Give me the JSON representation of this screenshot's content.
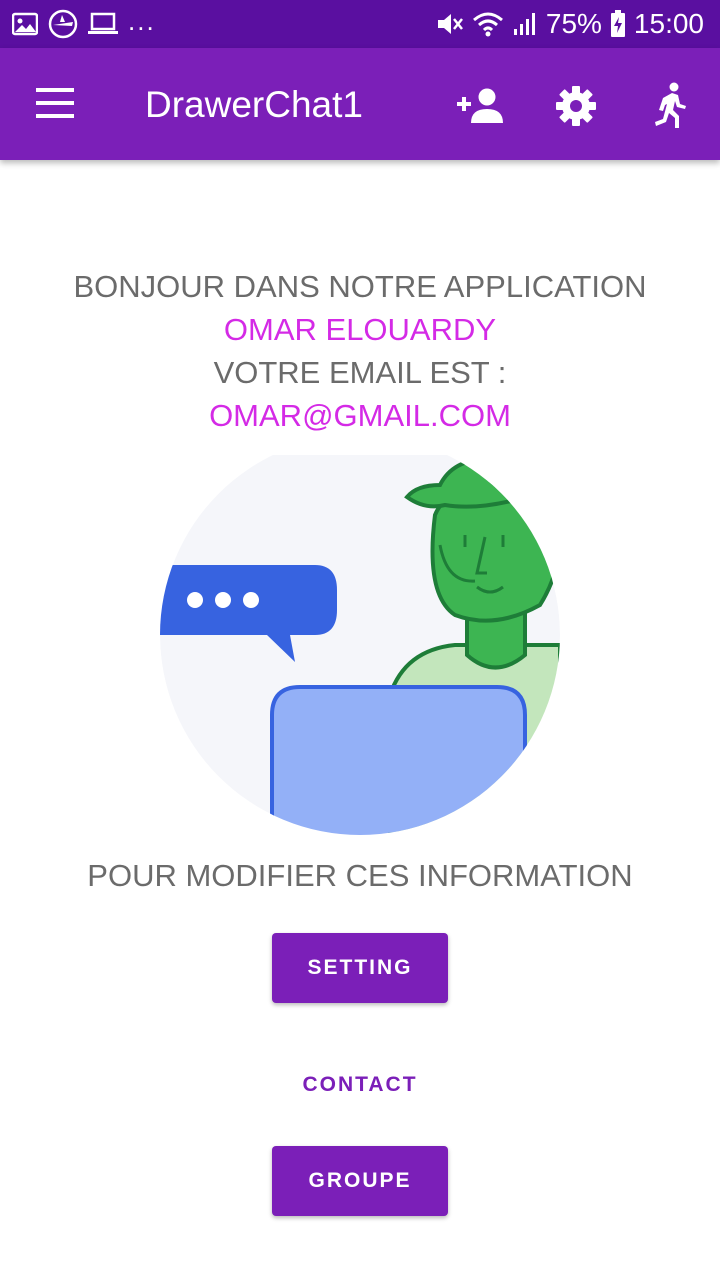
{
  "status_bar": {
    "left_icons": [
      "image-icon",
      "app-badge-icon",
      "laptop-icon"
    ],
    "overflow": "...",
    "right_icons": [
      "mute-icon",
      "wifi-icon",
      "signal-icon"
    ],
    "battery": "75%",
    "battery_icon": "battery-charging-icon",
    "time": "15:00"
  },
  "app_bar": {
    "title": "DrawerChat1",
    "actions": [
      "add-person-icon",
      "settings-icon",
      "logout-icon"
    ],
    "color": "#7b1fb8"
  },
  "welcome": {
    "line1": "BONJOUR DANS NOTRE APPLICATION",
    "name": "OMAR ELOUARDY",
    "line3": "VOTRE EMAIL EST :",
    "email": "OMAR@GMAIL.COM",
    "accent_color": "#d42ae6"
  },
  "modify_text": "POUR MODIFIER CES INFORMATION",
  "buttons": {
    "setting": "SETTING",
    "contact": "CONTACT",
    "groupe": "GROUPE"
  }
}
